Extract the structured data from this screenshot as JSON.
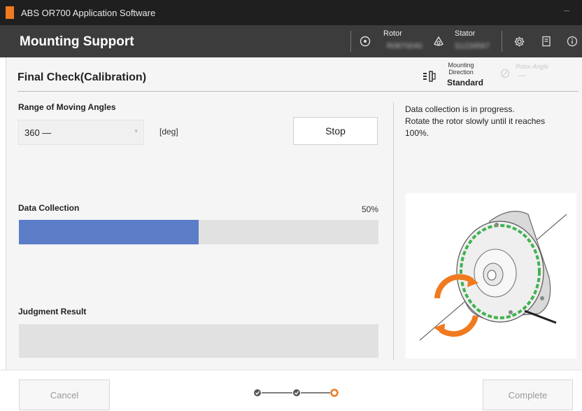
{
  "window": {
    "title": "ABS OR700 Application Software",
    "minimize_glyph": "–"
  },
  "header": {
    "app_title": "Mounting Support",
    "rotor_label": "Rotor",
    "rotor_value": "R0870040",
    "stator_label": "Stator",
    "stator_value": "S1234567",
    "icons": [
      "rotor-icon",
      "stator-icon",
      "gear-icon",
      "manual-icon",
      "info-icon"
    ]
  },
  "page": {
    "title": "Final Check(Calibration)",
    "mounting_direction_label_1": "Mounting",
    "mounting_direction_label_2": "Direction",
    "mounting_direction_value": "Standard",
    "rotor_angle_label": "Rotor Angle",
    "rotor_angle_value": "—"
  },
  "range": {
    "label": "Range of Moving Angles",
    "value": "360 —",
    "unit": "[deg]",
    "stop_label": "Stop"
  },
  "collection": {
    "label": "Data Collection",
    "percent_text": "50%",
    "progress": 0.5
  },
  "judgment": {
    "label": "Judgment Result",
    "value": ""
  },
  "message": {
    "line1": "Data collection is in progress.",
    "line2": "Rotate the rotor slowly until it reaches",
    "line3": "100%."
  },
  "footer": {
    "cancel_label": "Cancel",
    "complete_label": "Complete",
    "steps_total": 3,
    "current_step": 3
  },
  "colors": {
    "accent": "#f07a1f",
    "progress": "#5b7dc8",
    "header_bg": "#3c3c3c",
    "titlebar_bg": "#1f1f1f",
    "ring_green": "#3fb34f"
  }
}
